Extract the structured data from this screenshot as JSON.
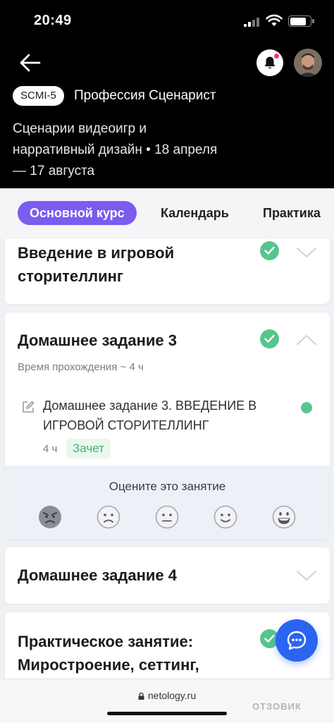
{
  "status_bar": {
    "time": "20:49"
  },
  "header": {
    "course_code": "SCMI-5",
    "course_title": "Профессия Сценарист",
    "course_desc": "Сценарии видеоигр и нарративный дизайн  •  18 апреля — 17 августа"
  },
  "tabs": [
    {
      "label": "Основной курс",
      "active": true
    },
    {
      "label": "Календарь",
      "active": false
    },
    {
      "label": "Практика",
      "active": false
    }
  ],
  "cards": {
    "intro": {
      "title": "Введение в игровой сторителлинг",
      "completed": true
    },
    "hw3": {
      "title": "Домашнее задание 3",
      "completed": true,
      "time_label": "Время прохождения ~ 4 ч",
      "lesson": {
        "title": "Домашнее задание 3. ВВЕДЕНИЕ В ИГРОВОЙ СТОРИТЕЛЛИНГ",
        "duration": "4 ч",
        "status": "Зачет"
      },
      "rating": {
        "label": "Оцените это занятие",
        "options": [
          "angry",
          "sad",
          "neutral",
          "smile",
          "grin"
        ]
      }
    },
    "hw4": {
      "title": "Домашнее задание 4"
    },
    "practice": {
      "title": "Практическое занятие: Миростроение, сеттинг,",
      "completed": true
    }
  },
  "browser": {
    "url": "netology.ru",
    "watermark": "ОТЗОВИК"
  },
  "colors": {
    "accent": "#7a5cf0",
    "success": "#56c68c",
    "fab": "#2b64f1",
    "notification": "#ee3d6c"
  }
}
